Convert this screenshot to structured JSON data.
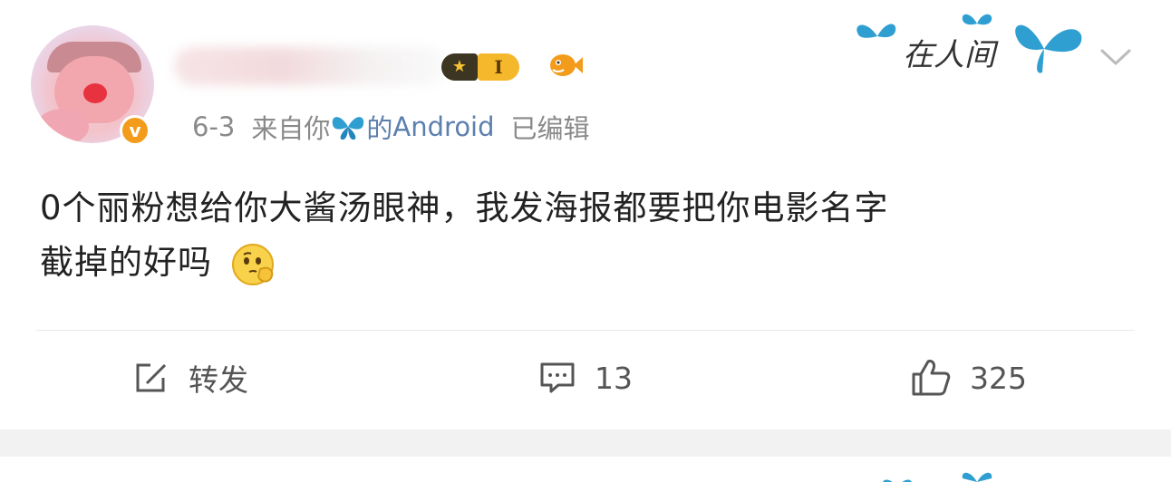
{
  "post": {
    "date": "6-3",
    "source_prefix": "来自你",
    "source_suffix": "的",
    "device": "Android",
    "edited": "已编辑",
    "level": "I",
    "content_line1": "0个丽粉想给你大酱汤眼神，我发海报都要把你电影名字",
    "content_line2": "截掉的好吗"
  },
  "watermark": {
    "text": "在人间"
  },
  "actions": {
    "forward_label": "转发",
    "comment_count": "13",
    "like_count": "325"
  },
  "colors": {
    "verified": "#f39c1b",
    "device_link": "#5c7fae",
    "butterfly": "#2f9fd1",
    "badge_gold": "#f5b72b"
  },
  "icons": [
    "verified-icon",
    "level-badge-icon",
    "fish-icon",
    "butterfly-icon",
    "chevron-down-icon",
    "forward-icon",
    "comment-icon",
    "like-icon",
    "thinking-emoji"
  ]
}
